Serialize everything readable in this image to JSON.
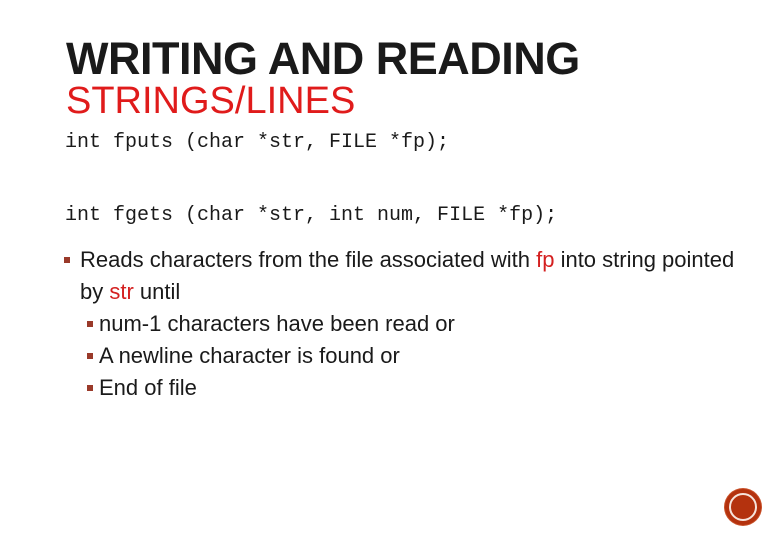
{
  "slide": {
    "title_line1": "WRITING AND READING",
    "title_line2": "STRINGS/LINES",
    "code_lines": [
      "int fputs (char *str, FILE *fp);",
      "int fgets (char *str, int num, FILE *fp);"
    ],
    "bullet": {
      "text_before_fp": "Reads characters from the file associated with ",
      "fp": "fp",
      "text_after_fp": " into string pointed by ",
      "str": "str",
      "text_end": " until"
    },
    "sub_bullets": [
      "num-1 characters have been read or",
      "A newline character is found or",
      "End of file"
    ]
  },
  "colors": {
    "title_accent": "#e01b1b",
    "highlight": "#d42020",
    "bullet": "#9a3a2a",
    "nav_button": "#b4320e"
  },
  "nav_button": {
    "icon": "circle-navigation-icon"
  }
}
